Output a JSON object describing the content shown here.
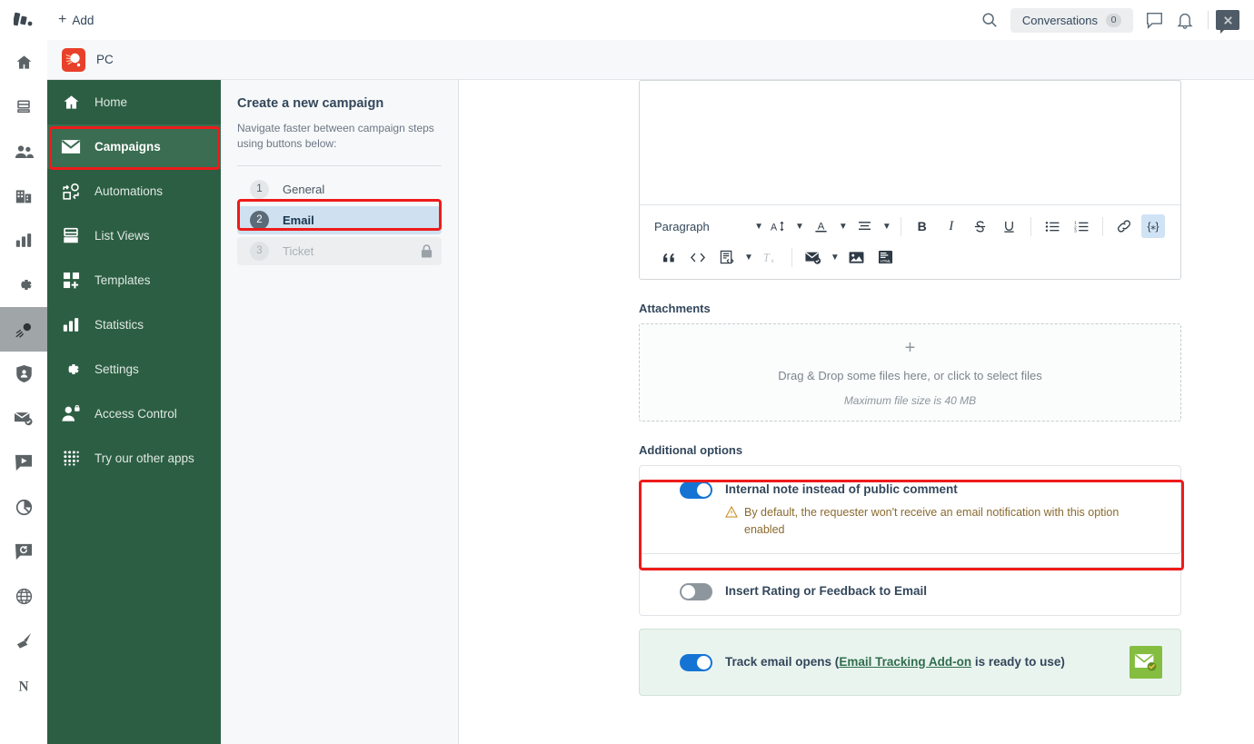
{
  "topbar": {
    "add_label": "Add",
    "search_icon": "search-icon",
    "conversations_label": "Conversations",
    "conversations_count": "0",
    "comment_icon": "comment-icon",
    "bell_icon": "bell-icon",
    "chat_icon": "chat-widget-icon"
  },
  "crm_header": {
    "title": "PC"
  },
  "app_rail": {
    "logo": "app-logo-icon",
    "items": [
      {
        "icon": "home-icon",
        "active": false
      },
      {
        "icon": "inbox-icon",
        "active": false
      },
      {
        "icon": "contacts-icon",
        "active": false
      },
      {
        "icon": "companies-icon",
        "active": false
      },
      {
        "icon": "reports-icon",
        "active": false
      },
      {
        "icon": "settings-gear-icon",
        "active": false
      },
      {
        "icon": "campaigns-rocket-icon",
        "active": true
      },
      {
        "icon": "shield-user-icon",
        "active": false
      },
      {
        "icon": "mail-check-icon",
        "active": false
      },
      {
        "icon": "video-chat-icon",
        "active": false
      },
      {
        "icon": "pie-chart-icon",
        "active": false
      },
      {
        "icon": "refresh-chat-icon",
        "active": false
      },
      {
        "icon": "globe-icon",
        "active": false
      },
      {
        "icon": "broom-icon",
        "active": false
      },
      {
        "icon": "letter-n-icon",
        "active": false
      }
    ]
  },
  "nav": {
    "items": [
      {
        "label": "Home",
        "icon": "home-icon",
        "selected": false
      },
      {
        "label": "Campaigns",
        "icon": "envelope-icon",
        "selected": true
      },
      {
        "label": "Automations",
        "icon": "automations-icon",
        "selected": false
      },
      {
        "label": "List Views",
        "icon": "list-views-icon",
        "selected": false
      },
      {
        "label": "Templates",
        "icon": "templates-icon",
        "selected": false
      },
      {
        "label": "Statistics",
        "icon": "bar-chart-icon",
        "selected": false
      },
      {
        "label": "Settings",
        "icon": "gear-icon",
        "selected": false
      },
      {
        "label": "Access Control",
        "icon": "user-lock-icon",
        "selected": false
      },
      {
        "label": "Try our other apps",
        "icon": "grid-dots-icon",
        "selected": false
      }
    ]
  },
  "steps_panel": {
    "title": "Create a new campaign",
    "subtitle": "Navigate faster between campaign steps using buttons below:",
    "steps": [
      {
        "num": "1",
        "label": "General",
        "state": "default"
      },
      {
        "num": "2",
        "label": "Email",
        "state": "active"
      },
      {
        "num": "3",
        "label": "Ticket",
        "state": "locked"
      }
    ]
  },
  "editor": {
    "paragraph_select": "Paragraph",
    "row1": [
      {
        "name": "font-size-icon",
        "glyph": "A↕",
        "state": "normal"
      },
      {
        "name": "font-color-icon",
        "glyph": "A",
        "state": "normal"
      },
      {
        "name": "align-icon",
        "glyph": "align",
        "state": "normal"
      },
      {
        "name": "bold-icon",
        "glyph": "B",
        "state": "normal"
      },
      {
        "name": "italic-icon",
        "glyph": "I",
        "state": "normal"
      },
      {
        "name": "strikethrough-icon",
        "glyph": "S",
        "state": "normal"
      },
      {
        "name": "underline-icon",
        "glyph": "U",
        "state": "normal"
      },
      {
        "name": "bullet-list-icon",
        "glyph": "ul",
        "state": "normal"
      },
      {
        "name": "numbered-list-icon",
        "glyph": "ol",
        "state": "normal"
      },
      {
        "name": "link-icon",
        "glyph": "link",
        "state": "normal"
      },
      {
        "name": "placeholder-icon",
        "glyph": "{*}",
        "state": "active"
      }
    ],
    "row2": [
      {
        "name": "blockquote-icon",
        "glyph": "quote",
        "state": "normal"
      },
      {
        "name": "code-icon",
        "glyph": "code",
        "state": "normal"
      },
      {
        "name": "snippet-icon",
        "glyph": "snippet",
        "state": "normal"
      },
      {
        "name": "clear-formatting-icon",
        "glyph": "Tx",
        "state": "disabled"
      },
      {
        "name": "email-template-icon",
        "glyph": "mail",
        "state": "normal"
      },
      {
        "name": "image-icon",
        "glyph": "image",
        "state": "normal"
      },
      {
        "name": "html-source-icon",
        "glyph": "html",
        "state": "normal"
      }
    ]
  },
  "attachments": {
    "title": "Attachments",
    "plus_icon": "plus-icon",
    "primary_text": "Drag & Drop some files here, or click to select files",
    "secondary_text": "Maximum file size is 40 MB"
  },
  "additional_options": {
    "title": "Additional options",
    "options": [
      {
        "name": "internal-note-option",
        "label": "Internal note instead of public comment",
        "toggle": "on",
        "warning_icon": "warning-triangle-icon",
        "note": "By default, the requester won't receive an email notification with this option enabled",
        "highlighted": true
      },
      {
        "name": "insert-rating-option",
        "label": "Insert Rating or Feedback to Email",
        "toggle": "off",
        "note": "",
        "highlighted": false
      },
      {
        "name": "track-email-opens-option",
        "label_prefix": "Track email opens (",
        "link_text": "Email Tracking Add-on",
        "label_suffix": " is ready to use)",
        "toggle": "on",
        "badge_icon": "mail-check-badge-icon",
        "highlighted": false
      }
    ]
  },
  "colors": {
    "nav_green": "#2c5e43",
    "nav_selected": "#3a6d51",
    "highlight_red": "#ee1b1b",
    "toggle_on": "#1574d3",
    "toggle_off": "#8d969d",
    "step_active": "#cfe1f0",
    "badge_green": "#84bd40",
    "warning_amber": "#8a6a2e"
  }
}
